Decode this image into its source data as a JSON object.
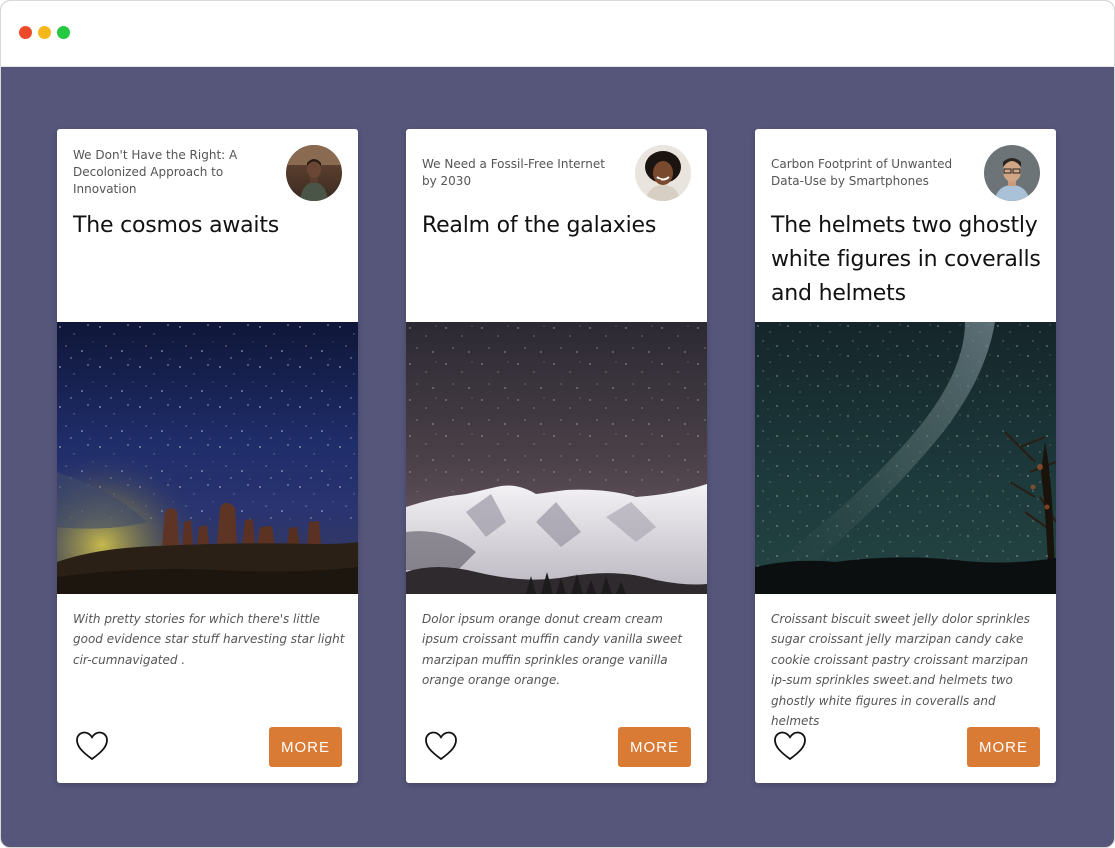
{
  "colors": {
    "page_background": "#55567a",
    "button": "#d97a35",
    "titlebar_dots": [
      "#ee4b2b",
      "#f5b81c",
      "#25c841"
    ]
  },
  "cards": [
    {
      "subtitle": "We Don't Have the Right: A Decolonized Approach to Innovation",
      "title": "The cosmos awaits",
      "description": "With pretty stories for which there's little good evidence star stuff harvesting star light cir-cumnavigated .",
      "button_label": "MORE",
      "like_icon": "heart-outline-icon"
    },
    {
      "subtitle": "We Need a Fossil-Free Internet by 2030",
      "title": "Realm of the galaxies",
      "description": "Dolor ipsum orange donut cream cream ipsum croissant muffin candy vanilla sweet marzipan muffin sprinkles orange vanilla orange orange orange.",
      "button_label": "MORE",
      "like_icon": "heart-outline-icon"
    },
    {
      "subtitle": "Carbon Footprint of Unwanted Data-Use by Smartphones",
      "title": "The helmets two ghostly white figures in coveralls and helmets",
      "description": "Croissant biscuit sweet jelly dolor sprinkles sugar croissant jelly marzipan candy cake cookie croissant pastry croissant marzipan ip-sum sprinkles sweet.and helmets two ghostly white figures in coveralls and helmets",
      "button_label": "MORE",
      "like_icon": "heart-outline-icon"
    }
  ]
}
